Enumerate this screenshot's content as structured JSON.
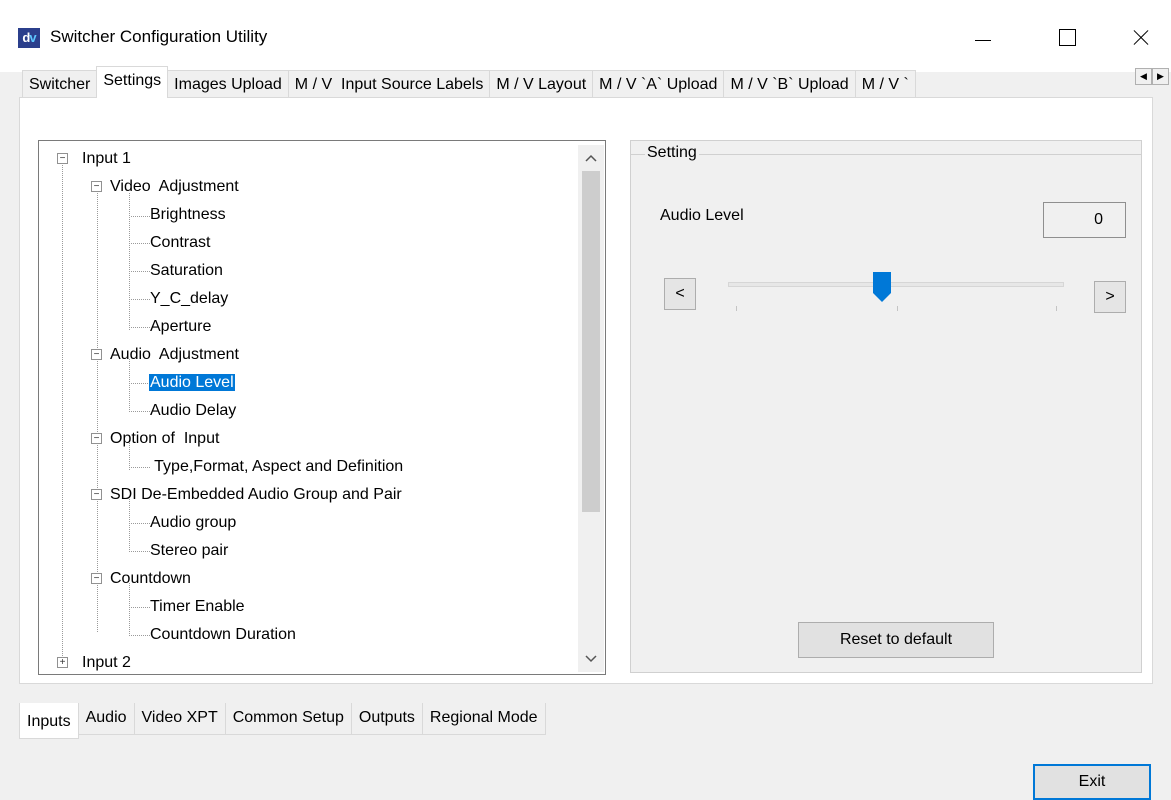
{
  "window": {
    "icon_text": "dv",
    "title": "Switcher Configuration Utility"
  },
  "top_tabs": [
    {
      "label": "Switcher"
    },
    {
      "label": "Settings"
    },
    {
      "label": "Images Upload"
    },
    {
      "label": "M / V  Input Source Labels"
    },
    {
      "label": "M / V Layout"
    },
    {
      "label": "M / V `A` Upload"
    },
    {
      "label": "M / V `B` Upload"
    },
    {
      "label": "M / V `"
    }
  ],
  "tree": {
    "items": [
      {
        "label": "Input 1",
        "expander": "−"
      },
      {
        "label": "Video  Adjustment",
        "expander": "−"
      },
      {
        "label": "Brightness"
      },
      {
        "label": "Contrast"
      },
      {
        "label": "Saturation"
      },
      {
        "label": "Y_C_delay"
      },
      {
        "label": "Aperture"
      },
      {
        "label": "Audio  Adjustment",
        "expander": "−"
      },
      {
        "label": "Audio Level"
      },
      {
        "label": "Audio Delay"
      },
      {
        "label": "Option of  Input",
        "expander": "−"
      },
      {
        "label": " Type,Format, Aspect and Definition"
      },
      {
        "label": "SDI De-Embedded Audio Group and Pair",
        "expander": "−"
      },
      {
        "label": "Audio group"
      },
      {
        "label": "Stereo pair"
      },
      {
        "label": "Countdown",
        "expander": "−"
      },
      {
        "label": "Timer Enable"
      },
      {
        "label": "Countdown Duration"
      },
      {
        "label": "Input 2",
        "expander": "+"
      }
    ],
    "selected": "Audio Level"
  },
  "setting": {
    "group_label": "Setting",
    "param_label": "Audio Level",
    "value": "0",
    "slider_fraction": 0.5,
    "dec_label": "<",
    "inc_label": ">",
    "reset_label": "Reset to default"
  },
  "bottom_tabs": [
    {
      "label": "Inputs"
    },
    {
      "label": "Audio"
    },
    {
      "label": "Video XPT"
    },
    {
      "label": "Common Setup"
    },
    {
      "label": "Outputs"
    },
    {
      "label": "Regional Mode"
    }
  ],
  "exit_label": "Exit",
  "colors": {
    "selection": "#0078d7",
    "slider_thumb": "#0078d7"
  }
}
